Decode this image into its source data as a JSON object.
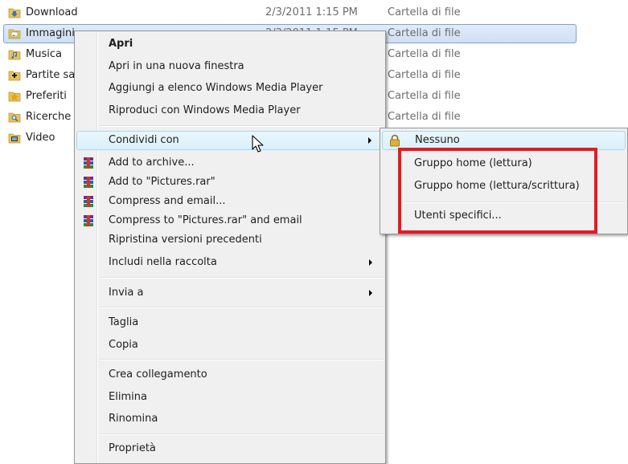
{
  "files": [
    {
      "name": "Download",
      "date": "2/3/2011 1:15 PM",
      "type": "Cartella di file",
      "icon": "downloads-folder-icon",
      "selected": false
    },
    {
      "name": "Immagini",
      "date": "2/3/2011 1:15 PM",
      "type": "Cartella di file",
      "icon": "pictures-folder-icon",
      "selected": true
    },
    {
      "name": "Musica",
      "date": "",
      "type": "Cartella di file",
      "icon": "music-folder-icon",
      "selected": false
    },
    {
      "name": "Partite sa",
      "date": "",
      "type": "Cartella di file",
      "icon": "saved-games-folder-icon",
      "selected": false
    },
    {
      "name": "Preferiti",
      "date": "",
      "type": "Cartella di file",
      "icon": "favorites-folder-icon",
      "selected": false
    },
    {
      "name": "Ricerche",
      "date": "",
      "type": "Cartella di file",
      "icon": "searches-folder-icon",
      "selected": false
    },
    {
      "name": "Video",
      "date": "",
      "type": "",
      "icon": "videos-folder-icon",
      "selected": false
    }
  ],
  "context_menu": {
    "open": "Apri",
    "open_new_window": "Apri in una nuova finestra",
    "add_wmp_list": "Aggiungi a elenco Windows Media Player",
    "play_wmp": "Riproduci con Windows Media Player",
    "share_with": "Condividi con",
    "add_to_archive": "Add to archive...",
    "add_to_rar": "Add to \"Pictures.rar\"",
    "compress_email": "Compress and email...",
    "compress_rar_email": "Compress to \"Pictures.rar\" and email",
    "restore_versions": "Ripristina versioni precedenti",
    "include_library": "Includi nella raccolta",
    "send_to": "Invia a",
    "cut": "Taglia",
    "copy": "Copia",
    "create_shortcut": "Crea collegamento",
    "delete": "Elimina",
    "rename": "Rinomina",
    "properties": "Proprietà"
  },
  "share_submenu": {
    "nobody": "Nessuno",
    "homegroup_read": "Gruppo home (lettura)",
    "homegroup_read_write": "Gruppo home (lettura/scrittura)",
    "specific_users": "Utenti specifici..."
  },
  "colors": {
    "highlight_box": "#e31b23",
    "selection_border": "#7da2ce",
    "menu_background": "#f0f0f0"
  }
}
